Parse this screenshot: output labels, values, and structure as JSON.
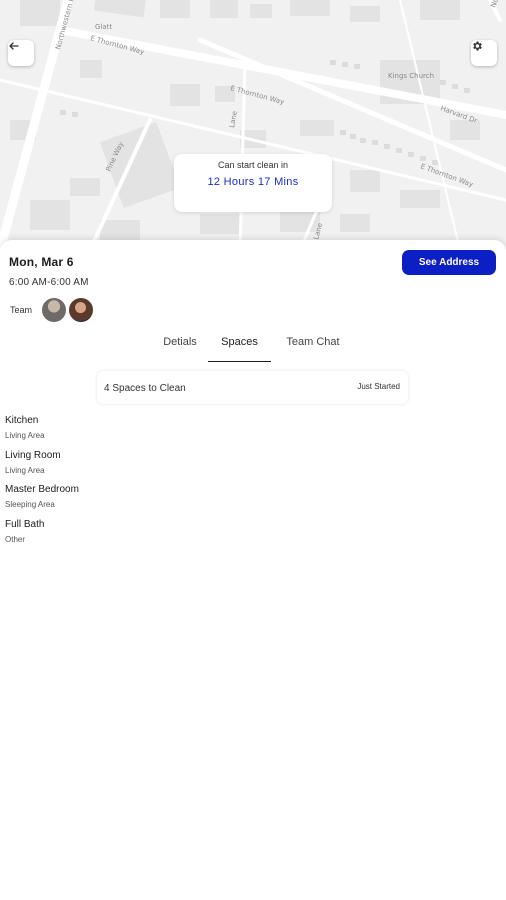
{
  "map": {
    "streets": [
      "Glatt",
      "E Thornton Way",
      "E Thornton Way",
      "Lane",
      "Lane",
      "E Thornton Way",
      "Kings Church",
      "Harvard Dr",
      "Pine Way",
      "Northwestern Rd",
      "Northwestern Rd"
    ],
    "eta": {
      "label": "Can start clean in",
      "value": "12 Hours 17 Mins"
    }
  },
  "header": {
    "date": "Mon, Mar 6",
    "time": "6:00 AM-6:00 AM",
    "see_address_label": "See Address",
    "team_label": "Team"
  },
  "tabs": [
    {
      "label": "Detials"
    },
    {
      "label": "Spaces"
    },
    {
      "label": "Team Chat"
    }
  ],
  "summary": {
    "count_text": "4 Spaces to Clean",
    "status": "Just Started"
  },
  "spaces": [
    {
      "name": "Kitchen",
      "type": "Living Area"
    },
    {
      "name": "Living Room",
      "type": "Living Area"
    },
    {
      "name": "Master Bedroom",
      "type": "Sleeping Area"
    },
    {
      "name": "Full Bath",
      "type": "Other"
    }
  ],
  "colors": {
    "accent": "#0c1fc4",
    "eta_text": "#1d2cc9",
    "map_background": "#f1f1f1"
  },
  "icons": {
    "back": "arrow-left-icon",
    "settings": "gear-icon"
  }
}
